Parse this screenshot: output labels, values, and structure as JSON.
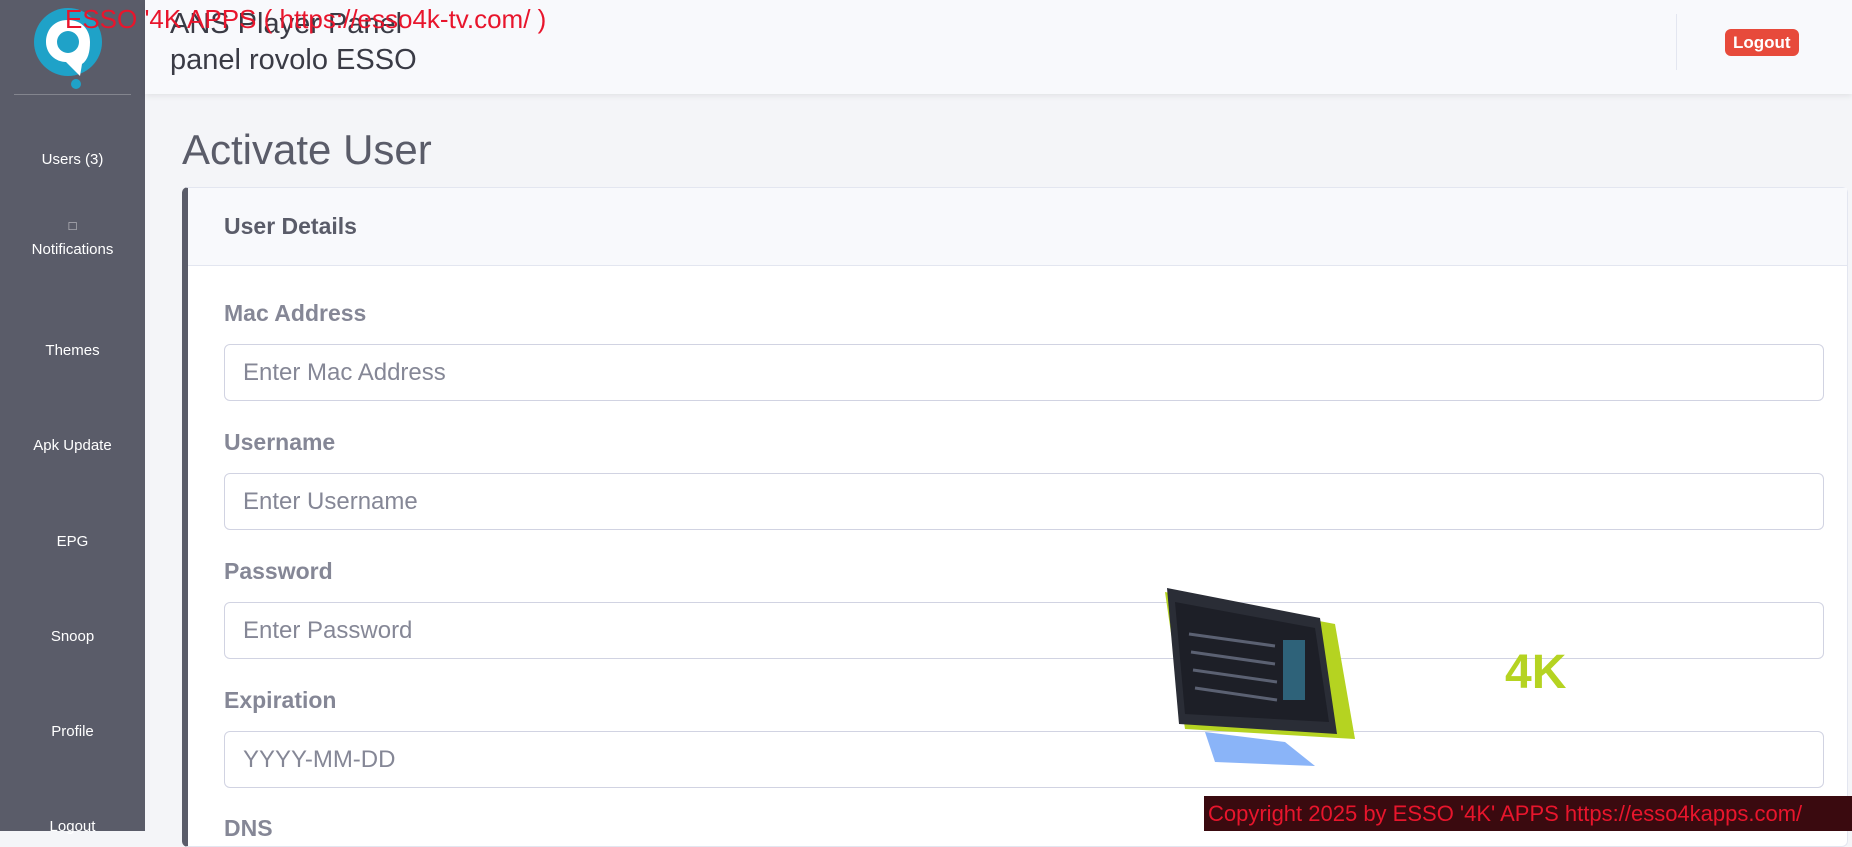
{
  "sidebar": {
    "items": [
      {
        "label": "Users (3)"
      },
      {
        "label": "Notifications",
        "icon": "bell-icon"
      },
      {
        "label": "Themes"
      },
      {
        "label": "Apk Update"
      },
      {
        "label": "EPG"
      },
      {
        "label": "Snoop"
      },
      {
        "label": "Profile"
      },
      {
        "label": "Logout"
      }
    ]
  },
  "topbar": {
    "app_title": "ANS Player Panel",
    "panel_name": "panel rovolo ESSO",
    "logout_label": "Logout"
  },
  "watermark_top": "ESSO '4K APPS ( https://esso4k-tv.com/ )",
  "page": {
    "heading": "Activate User"
  },
  "card": {
    "header": "User Details",
    "fields": [
      {
        "label": "Mac Address",
        "placeholder": "Enter Mac Address"
      },
      {
        "label": "Username",
        "placeholder": "Enter Username"
      },
      {
        "label": "Password",
        "placeholder": "Enter Password"
      },
      {
        "label": "Expiration",
        "placeholder": "YYYY-MM-DD"
      },
      {
        "label": "DNS"
      }
    ]
  },
  "promo": {
    "brand_text": "4K"
  },
  "copyright": "Copyright 2025  by ESSO '4K' APPS https://esso4kapps.com/",
  "colors": {
    "sidebar_bg": "#5a5c69",
    "logout_red": "#e74a3b",
    "watermark_red": "#e8152c",
    "brand_logo": "#1fa2c8",
    "promo_green": "#b5d321"
  }
}
